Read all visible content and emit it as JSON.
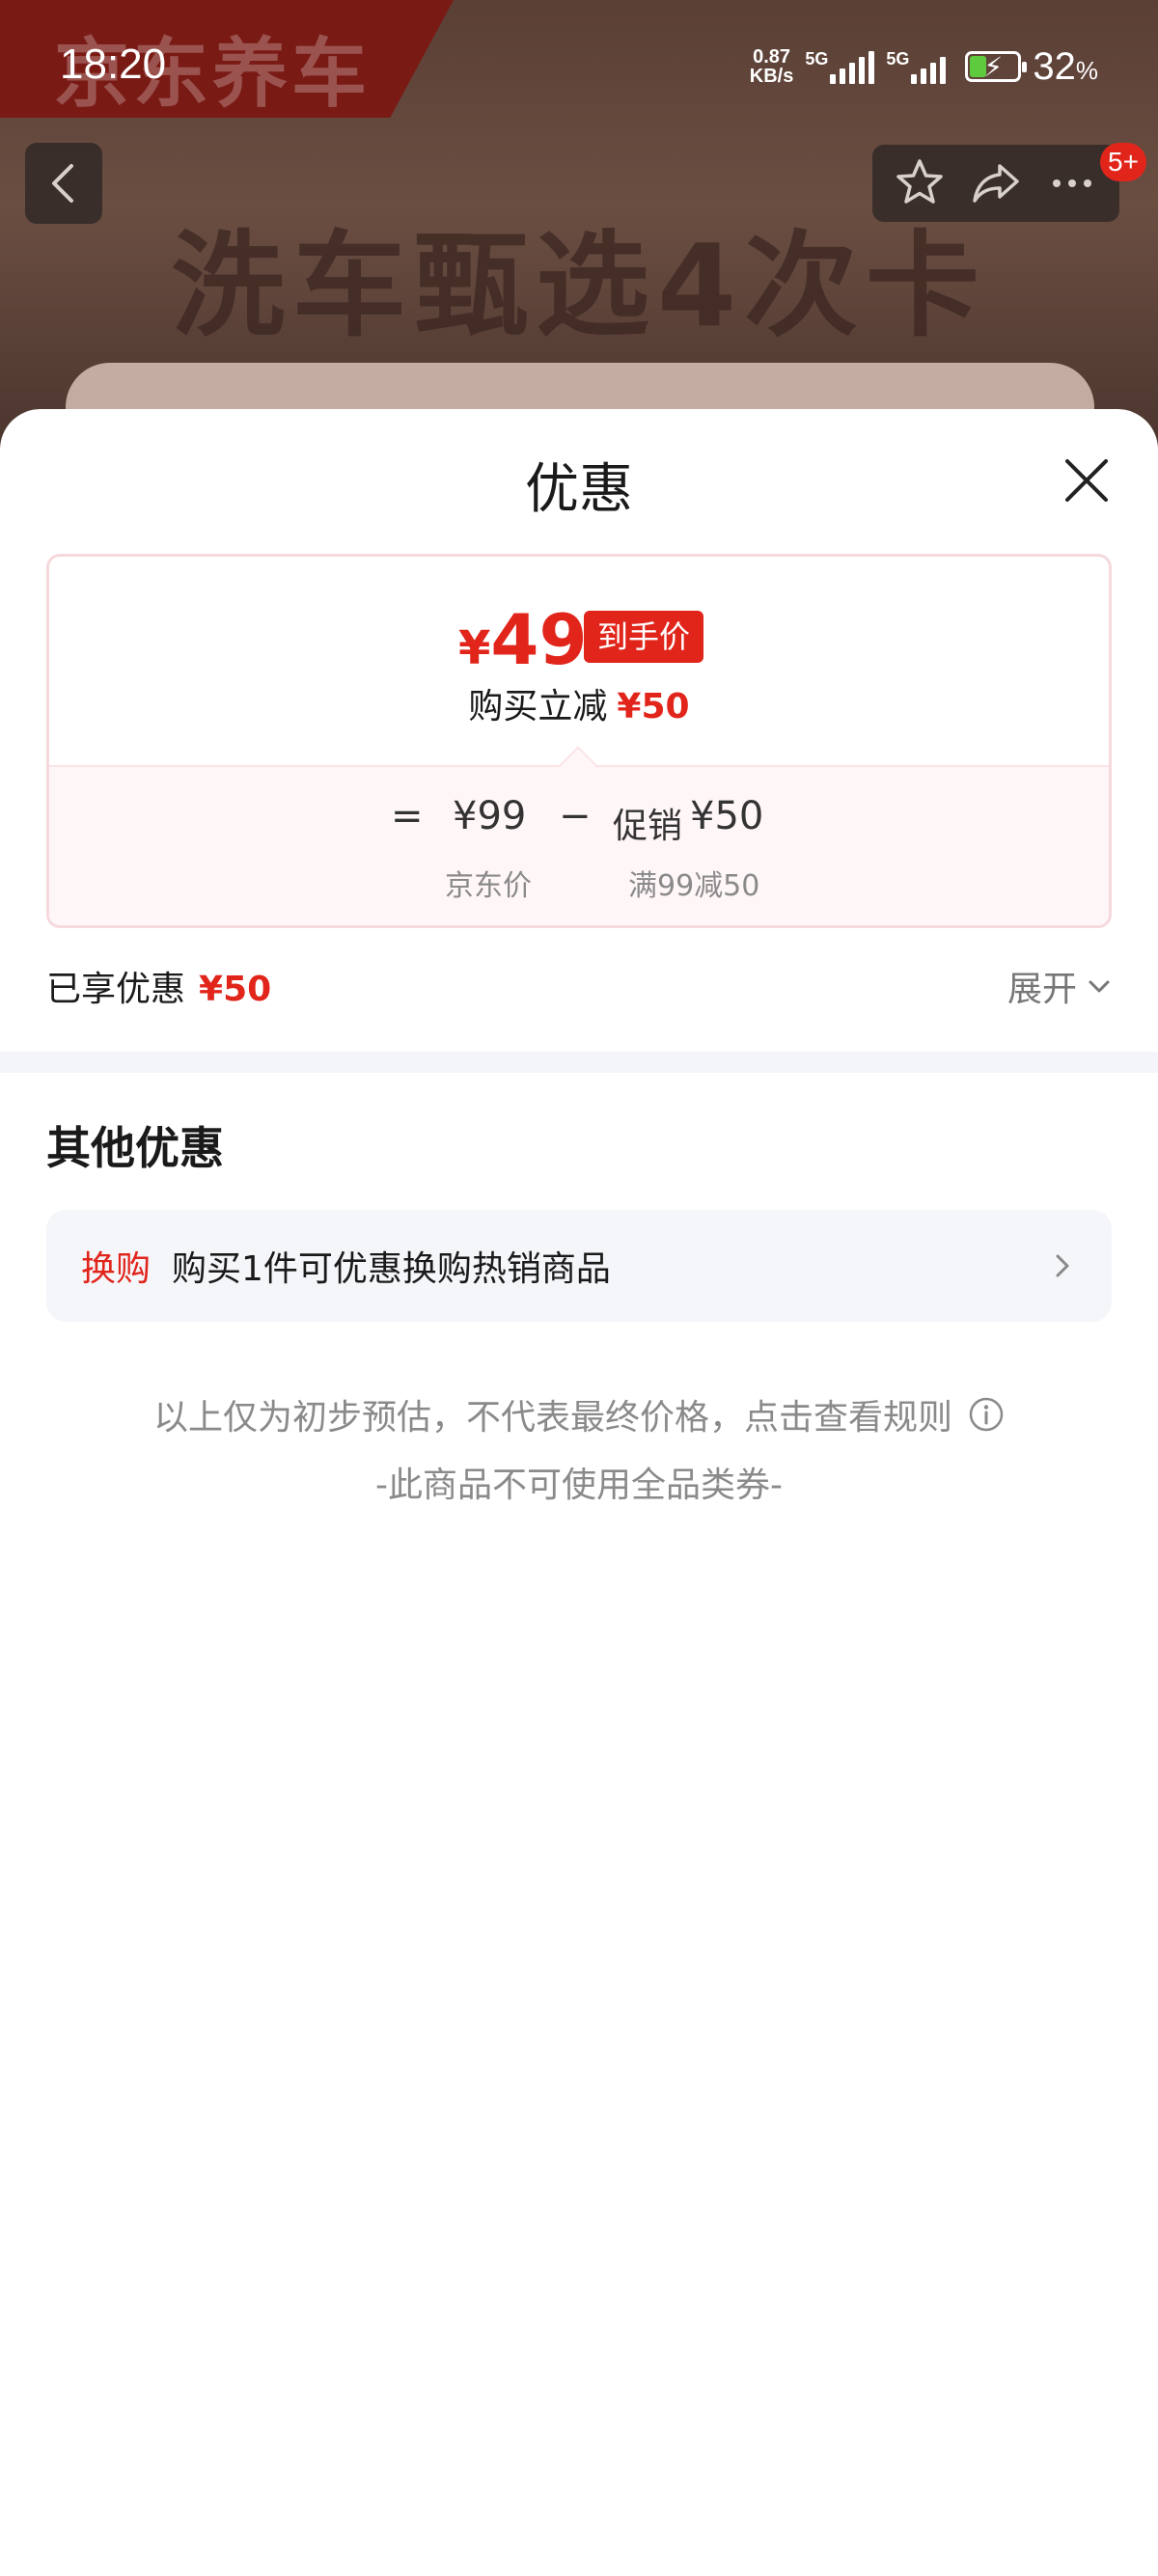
{
  "status_bar": {
    "time": "18:20",
    "net_speed_value": "0.87",
    "net_speed_unit": "KB/s",
    "signal1_label": "5G",
    "signal2_label": "5G",
    "battery_percent": "32",
    "battery_percent_unit": "%",
    "battery_level": 0.32,
    "battery_color": "#5ecb3f"
  },
  "background": {
    "brand": "京东养车",
    "headline": "洗车甄选4次卡",
    "pill_text": "一一一一 一一一一一一一",
    "pill_red": "一一一一"
  },
  "nav": {
    "back_icon": "chevron-left-icon",
    "favorite_icon": "star-icon",
    "share_icon": "share-icon",
    "more_icon": "more-icon",
    "badge": "5+"
  },
  "sheet": {
    "title": "优惠",
    "close_icon": "close-icon",
    "price_card": {
      "currency": "¥",
      "final_price": "49",
      "final_tag": "到手价",
      "reduce_label": "购买立减",
      "reduce_amount": "¥50",
      "equals": "=",
      "jd_price": "¥99",
      "minus": "−",
      "promo_label": "促销",
      "promo_amount": "¥50",
      "jd_price_label": "京东价",
      "promo_rule": "满99减50"
    },
    "enjoyed_label": "已享优惠",
    "enjoyed_amount": "¥50",
    "expand_label": "展开",
    "other_title": "其他优惠",
    "swap_tag": "换购",
    "swap_text": "购买1件可优惠换购热销商品",
    "disclaimer": "以上仅为初步预估，不代表最终价格，点击查看规则",
    "no_coupon": "-此商品不可使用全品类券-"
  },
  "colors": {
    "accent_red": "#e1251b",
    "card_border": "#f6d9dd",
    "row_bg": "#f5f6fa"
  }
}
